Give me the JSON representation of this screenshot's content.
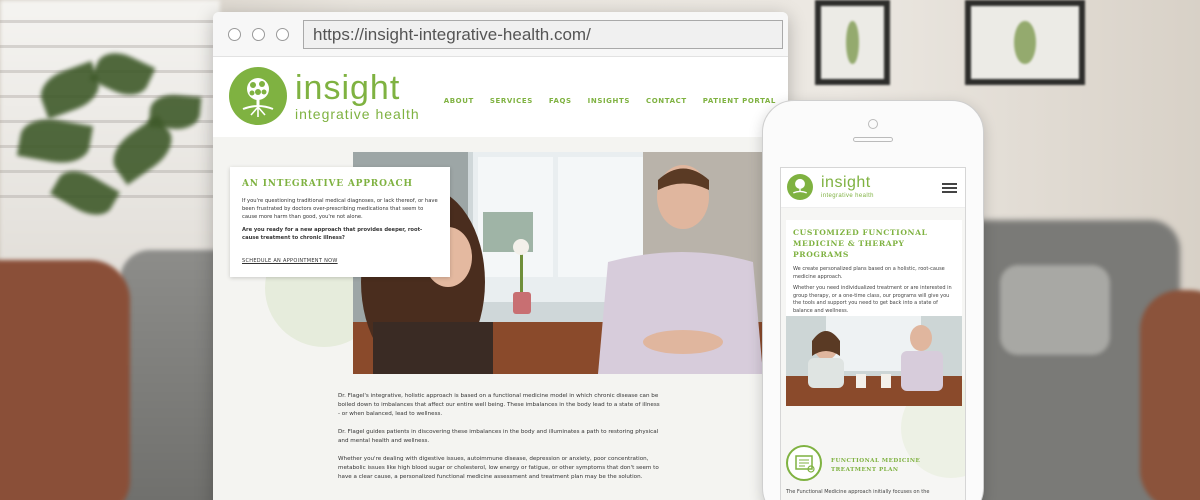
{
  "colors": {
    "brand_green": "#7fb241",
    "text": "#333333",
    "page_background": "#f4f4f1"
  },
  "browser": {
    "url": "https://insight-integrative-health.com/"
  },
  "site": {
    "logo_name": "insight",
    "logo_tagline": "integrative health",
    "nav": [
      "ABOUT",
      "SERVICES",
      "FAQS",
      "INSIGHTS",
      "CONTACT",
      "PATIENT PORTAL"
    ]
  },
  "hero_card": {
    "title": "AN INTEGRATIVE APPROACH",
    "paragraph1": "If you're questioning traditional medical diagnoses, or lack thereof, or have been frustrated by doctors over-prescribing medications that seem to cause more harm than good, you're not alone.",
    "paragraph2": "Are you ready for a new approach that provides deeper, root-cause treatment to chronic illness?",
    "cta": "SCHEDULE AN APPOINTMENT NOW"
  },
  "body": {
    "paragraph1": "Dr. Flagel's integrative, holistic approach is based on a functional medicine model in which chronic disease can be boiled down to imbalances that affect our entire well being. These imbalances in the body lead to a state of illness - or when balanced, lead to wellness.",
    "paragraph2": "Dr. Flagel guides patients in discovering these imbalances in the body and illuminates a path to restoring physical and mental health and wellness.",
    "paragraph3": "Whether you're dealing with digestive issues, autoimmune disease, depression or anxiety, poor concentration, metabolic issues like high blood sugar or cholesterol, low energy or fatigue, or other symptoms that don't seem to have a clear cause, a personalized functional medicine assessment and treatment plan may be the solution."
  },
  "mobile": {
    "card_title": "CUSTOMIZED FUNCTIONAL MEDICINE & THERAPY PROGRAMS",
    "card_paragraph1": "We create personalized plans based on a holistic, root-cause medicine approach.",
    "card_paragraph2": "Whether you need individualized treatment or are interested in group therapy, or a one-time class, our programs will give you the tools and support you need to get back into a state of balance and wellness.",
    "feature_title": "FUNCTIONAL MEDICINE TREATMENT PLAN",
    "feature_text": "The Functional Medicine approach initially focuses on the"
  }
}
